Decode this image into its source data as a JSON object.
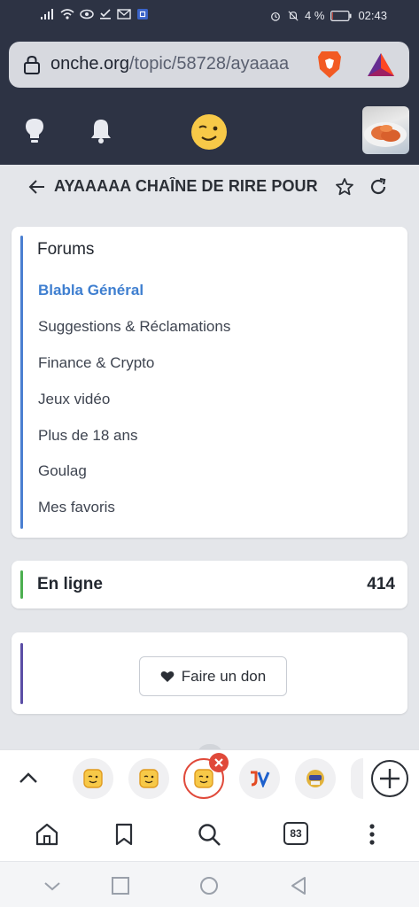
{
  "status_bar": {
    "battery_percent": "4 %",
    "time": "02:43",
    "battery_level": 0.04
  },
  "browser": {
    "url_host": "onche.org",
    "url_path": "/topic/58728/ayaaaa"
  },
  "topic": {
    "title": "AYAAAAA CHAÎNE DE RIRE POUR"
  },
  "forums": {
    "heading": "Forums",
    "items": [
      {
        "label": "Blabla Général",
        "active": true
      },
      {
        "label": "Suggestions & Réclamations",
        "active": false
      },
      {
        "label": "Finance & Crypto",
        "active": false
      },
      {
        "label": "Jeux vidéo",
        "active": false
      },
      {
        "label": "Plus de 18 ans",
        "active": false
      },
      {
        "label": "Goulag",
        "active": false
      },
      {
        "label": "Mes favoris",
        "active": false
      }
    ]
  },
  "online": {
    "label": "En ligne",
    "count": "414"
  },
  "donate": {
    "label": "Faire un don"
  },
  "toolbar": {
    "tab_count": "83"
  },
  "colors": {
    "header_bg": "#2d3344",
    "accent_blue": "#3f7fd0",
    "online_green": "#4caf50",
    "donate_purple": "#5b4ea6",
    "close_red": "#e0493a"
  }
}
